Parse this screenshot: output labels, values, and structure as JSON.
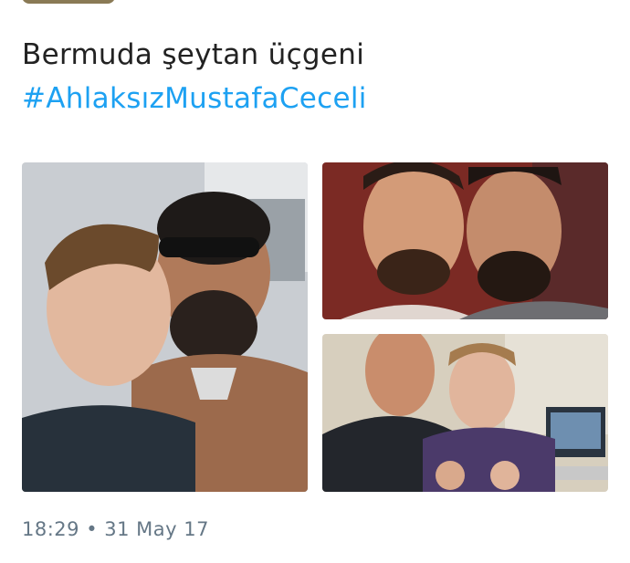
{
  "tweet": {
    "line1": "Bermuda şeytan üçgeni",
    "line2": "#AhlaksızMustafaCeceli",
    "timestamp": "18:29 • 31 May 17"
  },
  "media": [
    {
      "name": "photo-selfie-two-men-street"
    },
    {
      "name": "photo-two-bearded-men-smiling"
    },
    {
      "name": "photo-two-men-studio-fists"
    }
  ],
  "colors": {
    "hashtag": "#1da1f2",
    "text": "#222222",
    "meta": "#657786"
  }
}
